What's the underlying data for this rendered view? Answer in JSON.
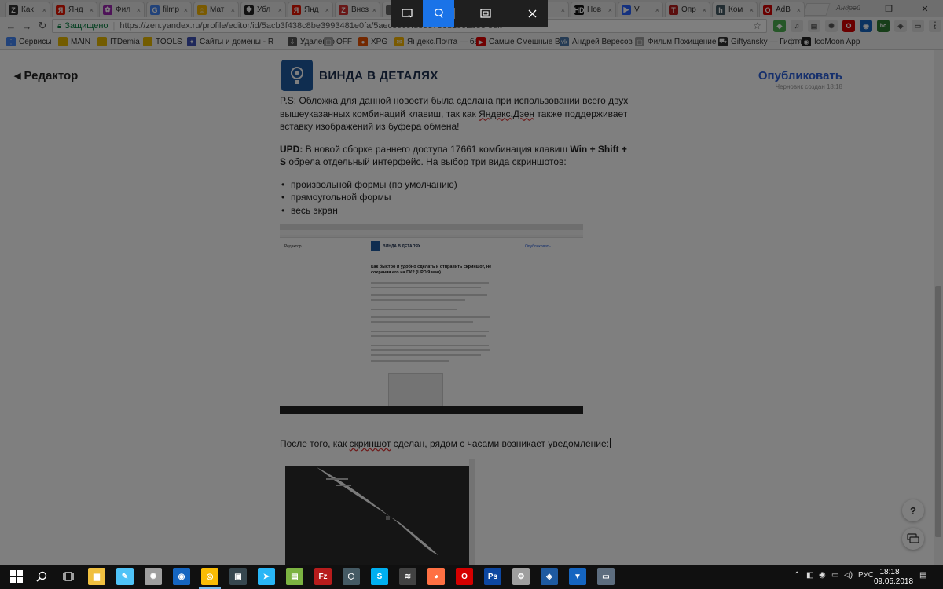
{
  "browser": {
    "tabs": [
      {
        "label": "Как",
        "icon": "zen-icon",
        "color": "#333333",
        "glyph": "Z"
      },
      {
        "label": "Янд",
        "icon": "yandex-icon",
        "color": "#e61400",
        "glyph": "Я"
      },
      {
        "label": "Фил",
        "icon": "film-icon",
        "color": "#9c27b0",
        "glyph": "✿"
      },
      {
        "label": "filmp",
        "icon": "google-icon",
        "color": "#4285f4",
        "glyph": "G"
      },
      {
        "label": "Мат",
        "icon": "smiley-icon",
        "color": "#f4b400",
        "glyph": "☺"
      },
      {
        "label": "Убл",
        "icon": "paw-icon",
        "color": "#222222",
        "glyph": "✱"
      },
      {
        "label": "Янд",
        "icon": "yandex-icon",
        "color": "#e61400",
        "glyph": "Я"
      },
      {
        "label": "Внез",
        "icon": "red-circle-icon",
        "color": "#d32f2f",
        "glyph": "Z"
      },
      {
        "label": "",
        "icon": "tab-icon",
        "color": "#666666",
        "glyph": ""
      },
      {
        "label": "",
        "icon": "tab-icon",
        "color": "#666666",
        "glyph": ""
      },
      {
        "label": "",
        "icon": "tab-icon",
        "color": "#666666",
        "glyph": ""
      },
      {
        "label": "",
        "icon": "tab-icon",
        "color": "#666666",
        "glyph": ""
      },
      {
        "label": "Нов",
        "icon": "hd-icon",
        "color": "#111111",
        "glyph": "HD"
      },
      {
        "label": "V",
        "icon": "video-icon",
        "color": "#2962ff",
        "glyph": "▶"
      },
      {
        "label": "Опр",
        "icon": "t-icon",
        "color": "#b71c1c",
        "glyph": "T"
      },
      {
        "label": "Ком",
        "icon": "h-icon",
        "color": "#455a64",
        "glyph": "h"
      },
      {
        "label": "AdB",
        "icon": "opera-icon",
        "color": "#d50000",
        "glyph": "O"
      }
    ],
    "profile_name": "Андрей",
    "window_buttons": [
      "—",
      "❐",
      "✕"
    ],
    "address": {
      "secure_label": "Защищено",
      "url": "https://zen.yandex.ru/profile/editor/id/5acb3f438c8be3993481e0fa/5aec80c9fd3087e0d1852b3e/edit"
    },
    "bookmarks": [
      {
        "label": "Сервисы",
        "icon": "apps-icon",
        "color": "#4285f4",
        "glyph": "⋮"
      },
      {
        "label": "MAIN",
        "icon": "folder-icon",
        "color": "#e6b800",
        "glyph": ""
      },
      {
        "label": "ITDemia",
        "icon": "folder-icon",
        "color": "#e6b800",
        "glyph": ""
      },
      {
        "label": "TOOLS",
        "icon": "folder-icon",
        "color": "#e6b800",
        "glyph": ""
      },
      {
        "label": "Сайты и домены - R",
        "icon": "puzzle-icon",
        "color": "#3f51b5",
        "glyph": "✦"
      },
      {
        "label": "Удаленто",
        "icon": "download-icon",
        "color": "#555555",
        "glyph": "⇩"
      },
      {
        "label": "OFF",
        "icon": "page-icon",
        "color": "#9e9e9e",
        "glyph": "▢"
      },
      {
        "label": "XPG",
        "icon": "pin-icon",
        "color": "#e65100",
        "glyph": "●"
      },
      {
        "label": "Яндекс.Почта — бе",
        "icon": "mail-icon",
        "color": "#f4b400",
        "glyph": "✉"
      },
      {
        "label": "Самые Смешные Ви",
        "icon": "youtube-icon",
        "color": "#e00000",
        "glyph": "▶"
      },
      {
        "label": "Андрей Вересов",
        "icon": "vk-icon",
        "color": "#4a76a8",
        "glyph": "vk"
      },
      {
        "label": "Фильм Похищение",
        "icon": "page-icon",
        "color": "#9e9e9e",
        "glyph": "▢"
      },
      {
        "label": "Giftyansky — Гифтя",
        "icon": "cart-icon",
        "color": "#333333",
        "glyph": "⛟"
      },
      {
        "label": "IcoMoon App",
        "icon": "icomoon-icon",
        "color": "#222222",
        "glyph": "◉"
      }
    ]
  },
  "snip_toolbar": {
    "tools": [
      "rectangular-snip",
      "freeform-snip",
      "fullscreen-snip",
      "close"
    ],
    "active": "freeform-snip",
    "active_color": "#1a73e8"
  },
  "editor": {
    "back_label": "Редактор",
    "brand": "ВИНДА В ДЕТАЛЯХ",
    "publish_label": "Опубликовать",
    "draft_status": "Черновик создан 18:18",
    "publish_color": "#2a5fd9",
    "ps_part1": "P.S: Обложка для данной новости была сделана при использовании всего двух вышеуказанных комбинаций клавиш, так как ",
    "ps_underlined": "Яндекс.Дзен",
    "ps_part2": " также поддерживает вставку изображений из буфера обмена!",
    "upd_prefix": "UPD:",
    "upd_part1": " В новой сборке раннего доступа 17661  комбинация клавиш ",
    "upd_keys": "Win + Shift + S",
    "upd_part2": " обрела отдельный интерфейс. На выбор три вида скриншотов:",
    "list": [
      "произвольной формы (по умолчанию)",
      "прямоугольной формы",
      "весь экран"
    ],
    "embedded": {
      "back": "Редактор",
      "brand": "ВИНДА В ДЕТАЛЯХ",
      "publish": "Опубликовать",
      "title": "Как быстро и удобно сделать и отправить скриншот, не сохраняя его на ПК? (UPD 9 мая)"
    },
    "after_part1": "После того, как ",
    "after_underlined": "скриншот",
    "after_part2": " сделан, рядом с часами возникает уведомление:",
    "help_label": "?"
  },
  "taskbar": {
    "apps": [
      {
        "name": "folder-app",
        "color": "#f0c040",
        "glyph": "▆"
      },
      {
        "name": "paint-app",
        "color": "#4fc3f7",
        "glyph": "✎"
      },
      {
        "name": "settings-cog-app",
        "color": "#9e9e9e",
        "glyph": "✺"
      },
      {
        "name": "password-app",
        "color": "#1565c0",
        "glyph": "◉"
      },
      {
        "name": "chrome-app",
        "color": "#fbbc05",
        "glyph": "◎"
      },
      {
        "name": "window-app",
        "color": "#37474f",
        "glyph": "▣"
      },
      {
        "name": "telegram-app",
        "color": "#29b6f6",
        "glyph": "➤"
      },
      {
        "name": "notepad-app",
        "color": "#7cb342",
        "glyph": "▤"
      },
      {
        "name": "filezilla-app",
        "color": "#b71c1c",
        "glyph": "Fz"
      },
      {
        "name": "virtualbox-app",
        "color": "#455a64",
        "glyph": "⬡"
      },
      {
        "name": "skype-app",
        "color": "#00aff0",
        "glyph": "S"
      },
      {
        "name": "steam-app",
        "color": "#424242",
        "glyph": "≋"
      },
      {
        "name": "firefox-app",
        "color": "#ff7043",
        "glyph": "◕"
      },
      {
        "name": "opera-app",
        "color": "#d50000",
        "glyph": "O"
      },
      {
        "name": "photoshop-app",
        "color": "#0d47a1",
        "glyph": "Ps"
      },
      {
        "name": "gear-app",
        "color": "#9e9e9e",
        "glyph": "⚙"
      },
      {
        "name": "zen-app",
        "color": "#1e5aa0",
        "glyph": "◈"
      },
      {
        "name": "bitwarden-app",
        "color": "#1565c0",
        "glyph": "▼"
      },
      {
        "name": "monitor-app",
        "color": "#5d6d7e",
        "glyph": "▭"
      }
    ],
    "lang": "РУС",
    "time": "18:18",
    "date": "09.05.2018"
  }
}
